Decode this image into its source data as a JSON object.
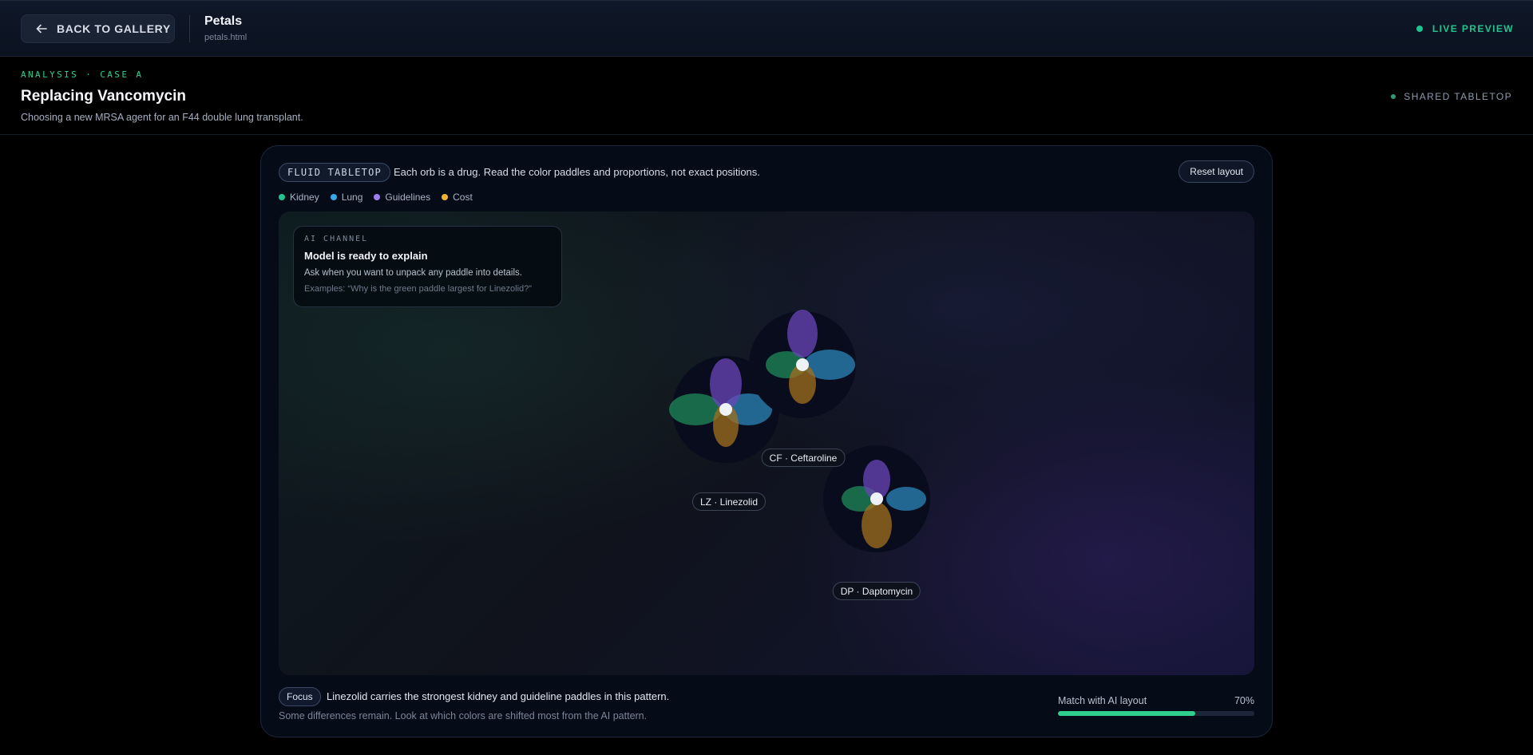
{
  "topbar": {
    "back_label": "BACK TO GALLERY",
    "title": "Petals",
    "file": "petals.html",
    "live_label": "LIVE PREVIEW"
  },
  "header": {
    "kicker": "ANALYSIS · CASE A",
    "title": "Replacing Vancomycin",
    "subtitle": "Choosing a new MRSA agent for an F44 double lung transplant.",
    "shared_label": "SHARED TABLETOP"
  },
  "panel": {
    "chip": "FLUID TABLETOP",
    "instructions": "Each orb is a drug. Read the color paddles and proportions, not exact positions.",
    "reset_label": "Reset layout",
    "legend": [
      {
        "label": "Kidney",
        "color": "#22c38e"
      },
      {
        "label": "Lung",
        "color": "#38a9e8"
      },
      {
        "label": "Guidelines",
        "color": "#9b7ff0"
      },
      {
        "label": "Cost",
        "color": "#f2b230"
      }
    ]
  },
  "ai_channel": {
    "kicker": "AI CHANNEL",
    "title": "Model is ready to explain",
    "body": "Ask when you want to unpack any paddle into details.",
    "examples": "Examples: “Why is the green paddle largest for Linezolid?”"
  },
  "orbs": [
    {
      "label": "LZ · Linezolid",
      "petals": {
        "kidney": 1.0,
        "lung": 0.8,
        "guidelines": 0.85,
        "cost": 0.65
      }
    },
    {
      "label": "CF · Ceftaroline",
      "petals": {
        "kidney": 0.7,
        "lung": 0.9,
        "guidelines": 1.0,
        "cost": 0.7
      }
    },
    {
      "label": "DP · Daptomycin",
      "petals": {
        "kidney": 0.65,
        "lung": 0.75,
        "guidelines": 0.8,
        "cost": 0.95
      }
    }
  ],
  "footer": {
    "focus_chip": "Focus",
    "focus_text": "Linezolid carries the strongest kidney and guideline paddles in this pattern.",
    "diff_text": "Some differences remain. Look at which colors are shifted most from the AI pattern.",
    "match_label": "Match with AI layout",
    "match_value": 0.7,
    "match_pct": "70%"
  }
}
